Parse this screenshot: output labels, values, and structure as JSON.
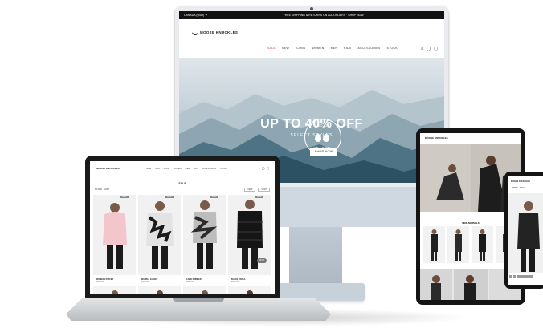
{
  "brand": {
    "name": "MOOSE KNUCKLES"
  },
  "desktop": {
    "promo_bar": {
      "left": "CANADA (USD) ▼",
      "center": "FREE SHIPPING & RETURNS ON ALL ORDERS · SHOP NOW"
    },
    "nav": [
      "SALE",
      "NEW",
      "ICONS",
      "WOMEN",
      "MEN",
      "KIDS",
      "ACCESSORIES",
      "STOCK"
    ],
    "hero": {
      "emblem_top": "END OF",
      "emblem_bottom": "SEASON",
      "headline": "UP TO 40% OFF",
      "subhead": "SELECT STYLES",
      "cta": "SHOP NOW"
    }
  },
  "laptop": {
    "nav": [
      "SALE",
      "NEW",
      "ICONS",
      "WOMEN",
      "MEN",
      "KIDS",
      "ACCESSORIES",
      "STOCK"
    ],
    "page_title": "SALE",
    "filter_label": "FILTER · SORT",
    "filter_right": [
      "VIEW",
      "SORT"
    ],
    "tag": "SALE",
    "products": [
      {
        "name": "WOMENS PUFFER",
        "price": "$495 USD",
        "swatch": "#f2c9cf"
      },
      {
        "name": "MARBLE JACKET",
        "price": "$595 USD",
        "swatch": "#cfcfcf"
      },
      {
        "name": "CAMO BOMBER",
        "price": "$645 USD",
        "swatch": "#9a9a9a"
      },
      {
        "name": "BLACK PARKA",
        "price": "$695 USD",
        "swatch": "#222222"
      }
    ],
    "chat_label": "CHAT"
  },
  "tablet": {
    "section_title": "NEW ARRIVALS"
  },
  "phone": {
    "title": "MENS · MEN'S"
  }
}
